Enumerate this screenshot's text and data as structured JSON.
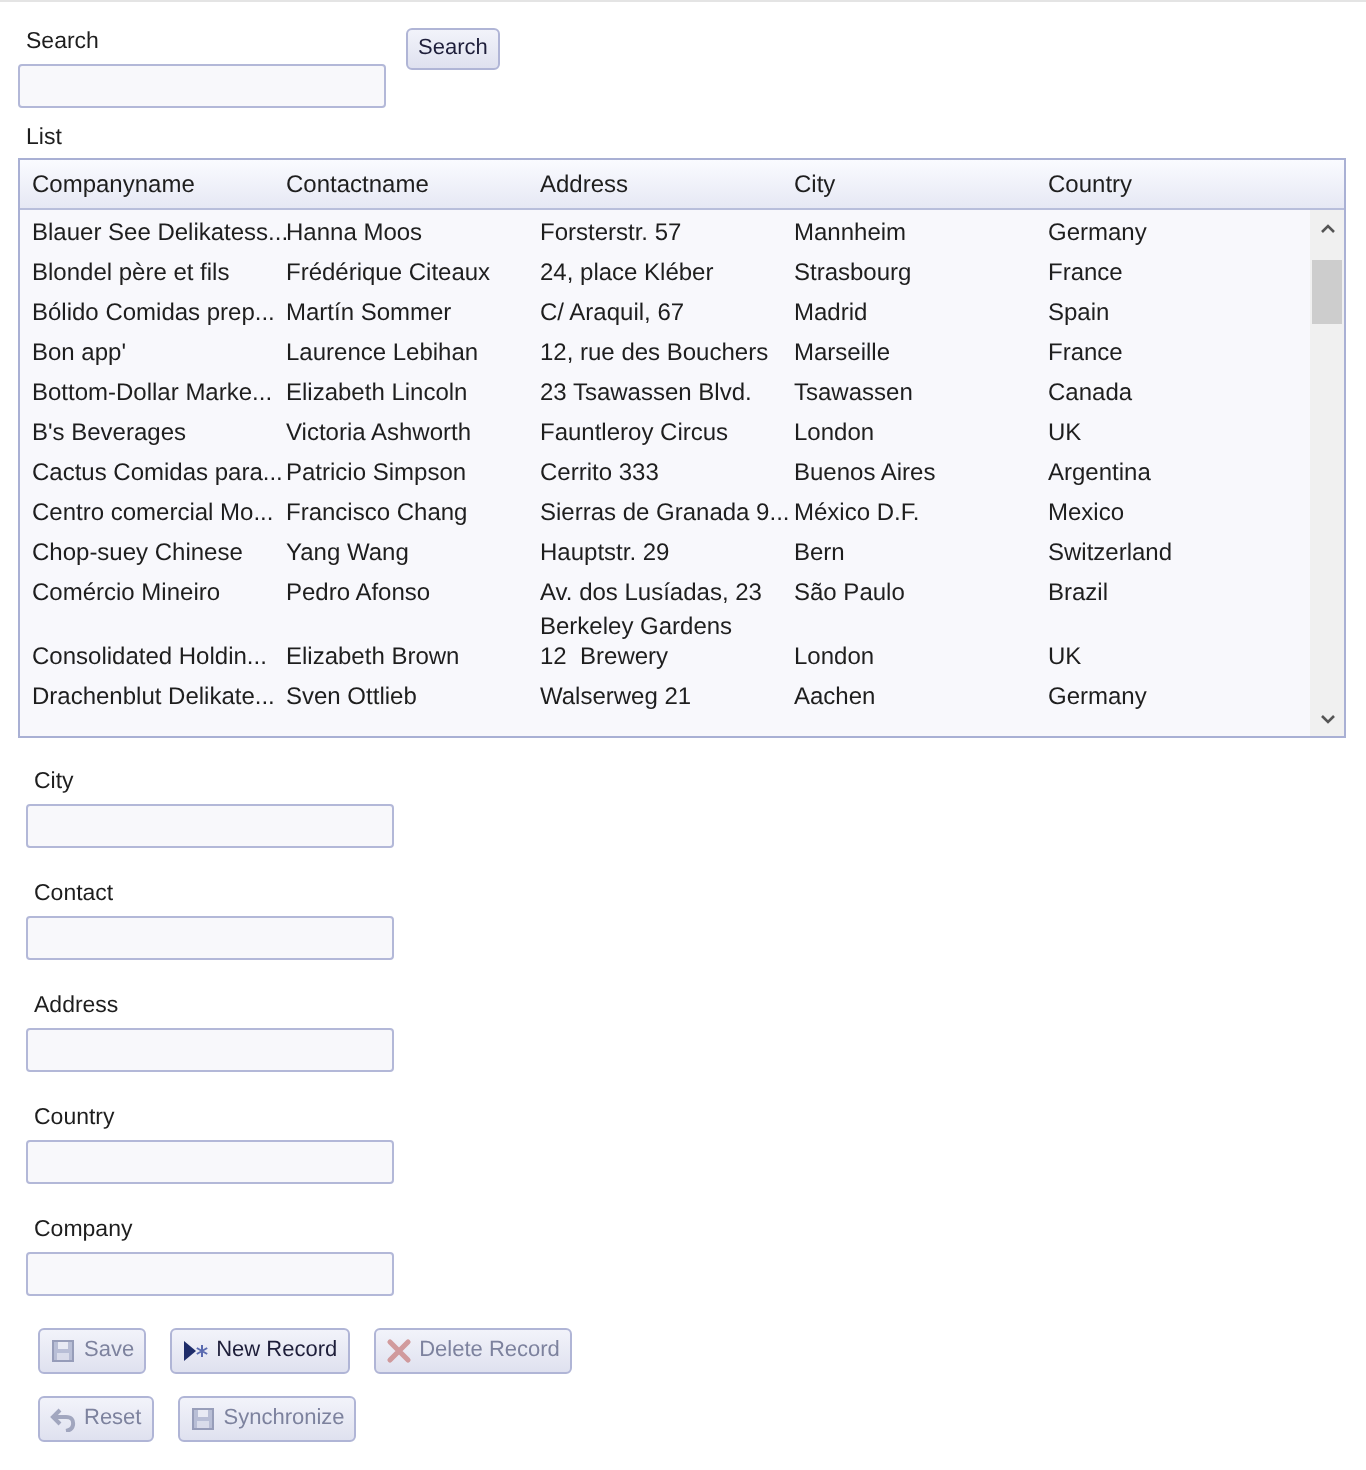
{
  "search": {
    "label": "Search",
    "button": "Search"
  },
  "list": {
    "label": "List",
    "columns": [
      "Companyname",
      "Contactname",
      "Address",
      "City",
      "Country"
    ],
    "rows": [
      [
        "Blauer See Delikatess...",
        "Hanna Moos",
        "Forsterstr. 57",
        "Mannheim",
        "Germany"
      ],
      [
        "Blondel père et fils",
        "Frédérique Citeaux",
        "24, place Kléber",
        "Strasbourg",
        "France"
      ],
      [
        "Bólido Comidas prep...",
        "Martín Sommer",
        "C/ Araquil, 67",
        "Madrid",
        "Spain"
      ],
      [
        "Bon app'",
        "Laurence Lebihan",
        "12, rue des Bouchers",
        "Marseille",
        "France"
      ],
      [
        "Bottom-Dollar Marke...",
        "Elizabeth Lincoln",
        "23 Tsawassen Blvd.",
        "Tsawassen",
        "Canada"
      ],
      [
        "B's Beverages",
        "Victoria Ashworth",
        "Fauntleroy Circus",
        "London",
        "UK"
      ],
      [
        "Cactus Comidas para...",
        "Patricio Simpson",
        "Cerrito 333",
        "Buenos Aires",
        "Argentina"
      ],
      [
        "Centro comercial Mo...",
        "Francisco Chang",
        "Sierras de Granada 9...",
        "México D.F.",
        "Mexico"
      ],
      [
        "Chop-suey Chinese",
        "Yang Wang",
        "Hauptstr. 29",
        "Bern",
        "Switzerland"
      ],
      [
        "Comércio Mineiro",
        "Pedro Afonso",
        "Av. dos Lusíadas, 23",
        "São Paulo",
        "Brazil"
      ],
      [
        "Consolidated Holdin...",
        "Elizabeth Brown",
        "Berkeley Gardens\n12  Brewery",
        "London",
        "UK"
      ],
      [
        "Drachenblut Delikate...",
        "Sven Ottlieb",
        "Walserweg 21",
        "Aachen",
        "Germany"
      ]
    ]
  },
  "fields": [
    {
      "label": "City"
    },
    {
      "label": "Contact"
    },
    {
      "label": "Address"
    },
    {
      "label": "Country"
    },
    {
      "label": "Company"
    }
  ],
  "buttons": [
    [
      {
        "label": "Save",
        "kind": "save",
        "disabled": true
      },
      {
        "label": "New Record",
        "kind": "new",
        "disabled": false
      },
      {
        "label": "Delete Record",
        "kind": "delete",
        "disabled": true
      }
    ],
    [
      {
        "label": "Reset",
        "kind": "reset",
        "disabled": true
      },
      {
        "label": "Synchronize",
        "kind": "save",
        "disabled": true
      }
    ]
  ]
}
